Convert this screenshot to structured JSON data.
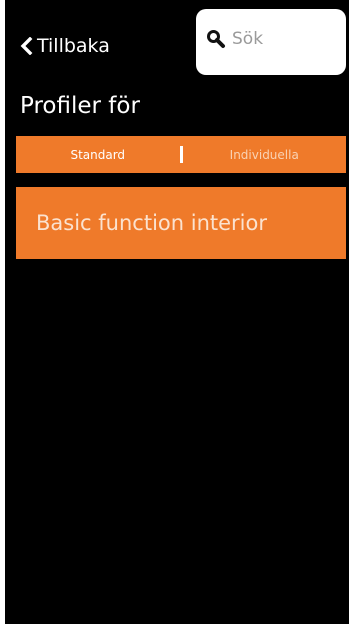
{
  "header": {
    "back_label": "Tillbaka",
    "back_icon": "chevron-left-icon",
    "search": {
      "placeholder": "Sök",
      "value": "",
      "icon": "search-icon"
    }
  },
  "page": {
    "title": "Profiler för"
  },
  "tabs": [
    {
      "label": "Standard",
      "active": true
    },
    {
      "label": "Individuella",
      "active": false
    }
  ],
  "profiles": [
    {
      "label": "Basic function interior"
    }
  ],
  "colors": {
    "background": "#000000",
    "accent": "#ef7a2a",
    "text": "#ffffff",
    "inactive_text": "#f9d2b4",
    "search_bg": "#ffffff",
    "placeholder": "#9a9a9a"
  }
}
